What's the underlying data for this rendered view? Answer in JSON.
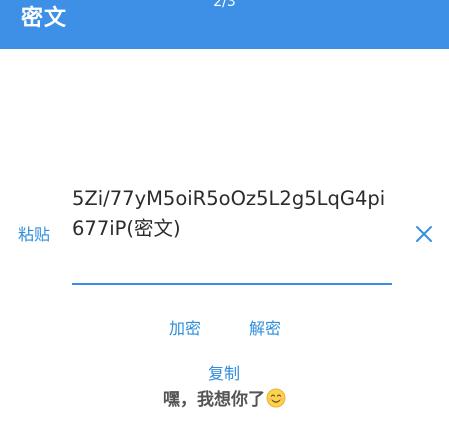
{
  "header": {
    "title": "密文",
    "page_indicator": "2/3"
  },
  "cipher": {
    "paste_label": "粘贴",
    "value": "5Zi/77yM5oiR5oOz5L2g5LqG4pi677iP(密文)",
    "clear_icon": "close-icon"
  },
  "actions": {
    "encrypt_label": "加密",
    "decrypt_label": "解密",
    "copy_label": "复制"
  },
  "plain": {
    "text": "嘿，我想你了",
    "emoji": "smiling-face-icon"
  },
  "colors": {
    "app_bar": "#3e8fe6",
    "accent": "#2f8ddc",
    "text": "#2b2b2b",
    "plain_text": "#555555"
  }
}
